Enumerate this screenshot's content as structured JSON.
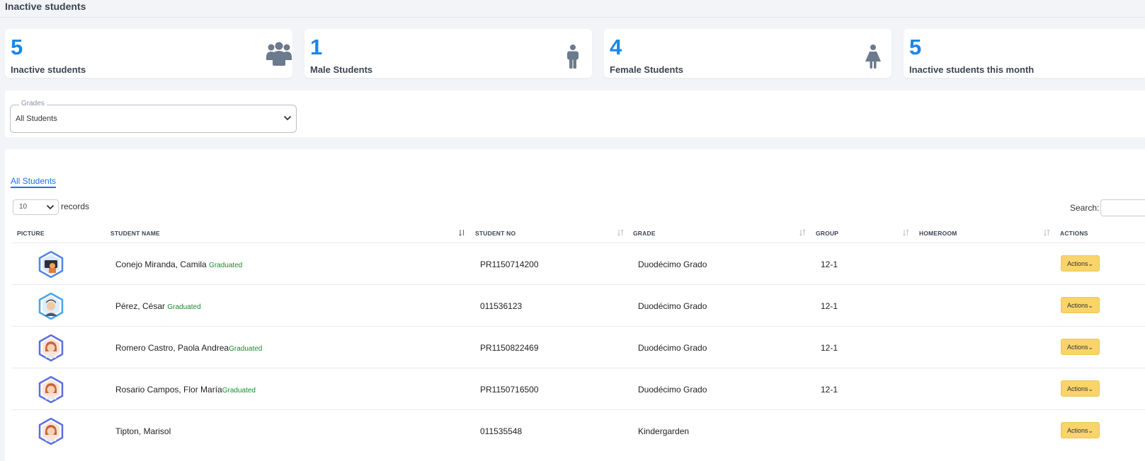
{
  "page_title": "Inactive students",
  "stats": [
    {
      "value": "5",
      "label": "Inactive students",
      "icon": "group-icon"
    },
    {
      "value": "1",
      "label": "Male Students",
      "icon": "male-icon"
    },
    {
      "value": "4",
      "label": "Female Students",
      "icon": "female-icon"
    },
    {
      "value": "5",
      "label": "Inactive students this month",
      "icon": ""
    }
  ],
  "filter": {
    "legend": "Grades",
    "value": "All Students"
  },
  "table_controls": {
    "tab_label": "All Students",
    "length_value": "10",
    "records_label": "records",
    "search_label": "Search:"
  },
  "columns": {
    "picture": "PICTURE",
    "student_name": "STUDENT NAME",
    "student_no": "STUDENT NO",
    "grade": "GRADE",
    "group": "GROUP",
    "homeroom": "HOMEROOM",
    "actions": "ACTIONS"
  },
  "rows": [
    {
      "name": "Conejo Miranda, Camila",
      "status": "Graduated",
      "student_no": "PR1150714200",
      "grade": "Duodécimo Grado",
      "group": "12-1",
      "homeroom": "",
      "action": "Actions"
    },
    {
      "name": "Pérez, César",
      "status": "Graduated",
      "student_no": "011536123",
      "grade": "Duodécimo Grado",
      "group": "12-1",
      "homeroom": "",
      "action": "Actions"
    },
    {
      "name": "Romero Castro, Paola Andrea",
      "status": "Graduated",
      "student_no": "PR1150822469",
      "grade": "Duodécimo Grado",
      "group": "12-1",
      "homeroom": "",
      "action": "Actions"
    },
    {
      "name": "Rosario Campos, Flor María",
      "status": "Graduated",
      "student_no": "PR1150716500",
      "grade": "Duodécimo Grado",
      "group": "12-1",
      "homeroom": "",
      "action": "Actions"
    },
    {
      "name": "Tipton, Marisol",
      "status": "",
      "student_no": "011535548",
      "grade": "Kindergarden",
      "group": "",
      "homeroom": "",
      "action": "Actions"
    }
  ],
  "colors": {
    "accent": "#1a86e8",
    "graduated": "#1b8a2e",
    "action_button": "#f8d46a",
    "icon_gray": "#6b7a8c"
  }
}
